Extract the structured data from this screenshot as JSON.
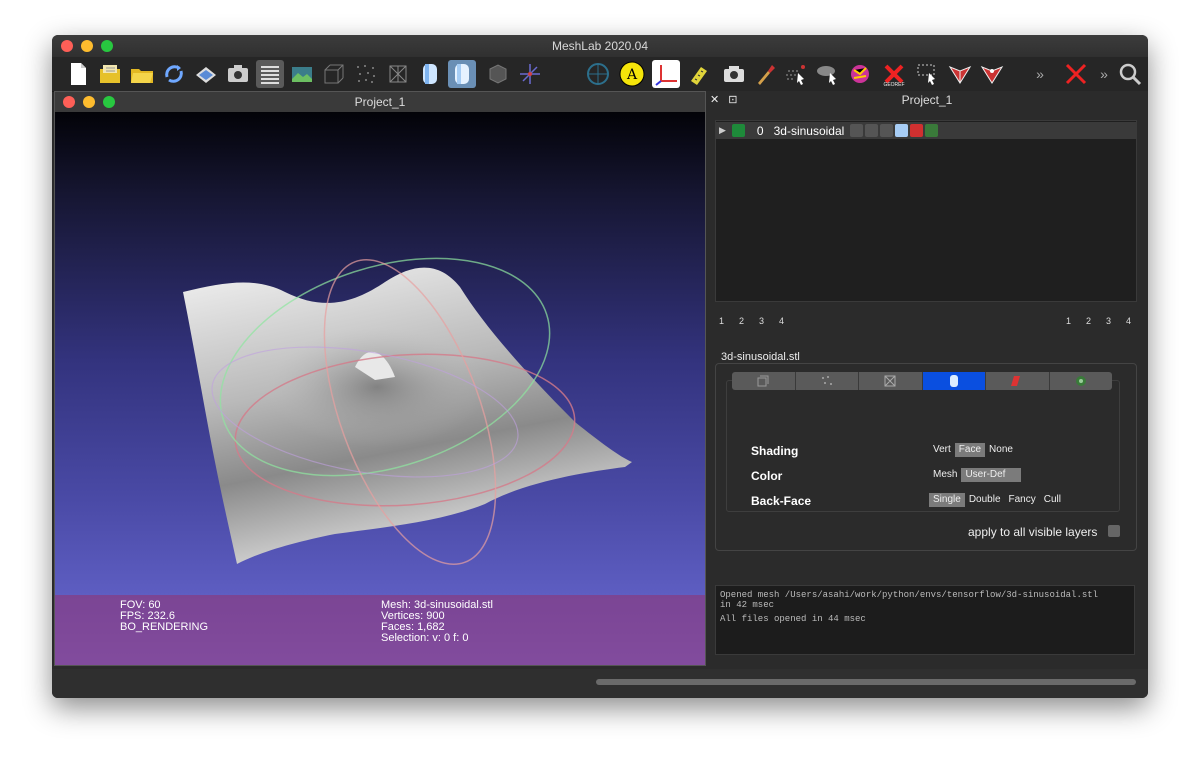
{
  "app": {
    "title": "MeshLab 2020.04"
  },
  "toolbar": {
    "icons": [
      "new-document-icon",
      "import-mesh-icon",
      "open-project-icon",
      "reload-icon",
      "save-icon",
      "snapshot-icon",
      "layers-icon",
      "raster-icon",
      "bbox-icon",
      "points-icon",
      "wireframe-icon",
      "flat-shading-icon",
      "smooth-shading-icon",
      "trackball-icon",
      "axis-icon",
      "ruler-icon",
      "annotation-icon",
      "axes-icon",
      "measure-icon",
      "camera-icon",
      "paint-icon",
      "select-vertices-icon",
      "select-faces-icon",
      "georef-icon",
      "select-connected-icon",
      "select-area-icon",
      "edit-mesh-icon",
      "pick-points-icon",
      "more-icon",
      "delete-icon",
      "more-icon-2",
      "search-icon"
    ]
  },
  "viewer": {
    "title": "Project_1",
    "info": {
      "fov": "FOV: 60",
      "fps": "FPS:   232.6",
      "rendering": "BO_RENDERING",
      "mesh": "Mesh: 3d-sinusoidal.stl",
      "vertices": "Vertices: 900",
      "faces": "Faces: 1,682",
      "selection": "Selection: v: 0 f: 0"
    }
  },
  "layers_panel": {
    "title": "Project_1",
    "layer": {
      "index": "0",
      "name": "3d-sinusoidal"
    },
    "views_left": [
      "1",
      "2",
      "3",
      "4"
    ],
    "views_right": [
      "1",
      "2",
      "3",
      "4"
    ],
    "file_name": "3d-sinusoidal.stl",
    "tabs": [
      "bbox",
      "points",
      "wireframe",
      "fill",
      "texture",
      "settings"
    ],
    "properties": {
      "shading_label": "Shading",
      "shading_options": [
        "Vert",
        "Face",
        "None"
      ],
      "shading_selected": "Face",
      "color_label": "Color",
      "color_options": [
        "Mesh",
        "User-Def"
      ],
      "color_selected": "User-Def",
      "backface_label": "Back-Face",
      "backface_options": [
        "Single",
        "Double",
        "Fancy",
        "Cull"
      ],
      "backface_selected": "Single"
    },
    "apply_all": "apply to all visible layers"
  },
  "log": {
    "line1": "Opened mesh /Users/asahi/work/python/envs/tensorflow/3d-sinusoidal.stl",
    "line2": "in 42 msec",
    "line3": "All files opened in 44 msec"
  },
  "colors": {
    "accent": "#0a4fe0",
    "info_band": "#943270"
  }
}
